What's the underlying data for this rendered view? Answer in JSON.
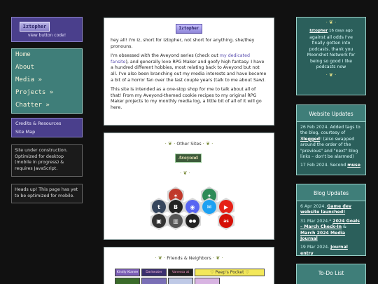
{
  "left": {
    "button_label": "Iztopher",
    "button_caption": "view button code!",
    "nav": [
      "Home",
      "About",
      "Media »",
      "Projects »",
      "Chatter »"
    ],
    "sub": [
      "Credits & Resources",
      "Site Map"
    ],
    "notice1": "Site under construction. Optimized for desktop (mobile in progress) & requires JavaScript.",
    "notice2": "Heads up! This page has yet to be optimized for mobile."
  },
  "intro": {
    "badge": "Iztopher",
    "p1": "hey all! I'm Iz, short for Iztopher, not short for anything. she/they pronouns.",
    "p2a": "I'm obsessed with the Aveyond series (check out ",
    "p2link": "my dedicated fansite",
    "p2b": "), and generally love RPG Maker and goofy high fantasy. I have a hundred different hobbies, most relating back to Aveyond but not all. I've also been branching out my media interests and have become a bit of a horror fan over the last couple years (talk to me about Saw).",
    "p3": "This site is intended as a one-stop shop for me to talk about all of that! From my Aveyond-themed cookie recipes to my original RPG Maker projects to my monthly media log, a little bit of all of it will go here."
  },
  "other_sites": {
    "title": "Other Sites",
    "button": "Aveyond",
    "icons": [
      {
        "name": "rpg-maker-icon",
        "glyph": "✶",
        "color": "#c0392b"
      },
      {
        "name": "fansite-icon",
        "glyph": "✦",
        "color": "#2e8b57"
      },
      {
        "name": "tumblr-icon",
        "glyph": "t",
        "color": "#36465d"
      },
      {
        "name": "bluesky-icon",
        "glyph": "B",
        "color": "#222"
      },
      {
        "name": "discord-icon",
        "glyph": "◉",
        "color": "#5865f2"
      },
      {
        "name": "twitter-icon",
        "glyph": "✉",
        "color": "#1da1f2"
      },
      {
        "name": "youtube-icon",
        "glyph": "▶",
        "color": "#e62117"
      },
      {
        "name": "itch-icon",
        "glyph": "▣",
        "color": "#333"
      },
      {
        "name": "library-icon",
        "glyph": "▥",
        "color": "#555"
      },
      {
        "name": "flickr-icon",
        "glyph": "●●",
        "color": "#fff"
      },
      {
        "name": "lastfm-icon",
        "glyph": "as",
        "color": "#d51007"
      }
    ]
  },
  "friends": {
    "title": "Friends & Neighbors",
    "buttons": [
      "Kindly Klanee",
      "Darkwater",
      "Vanessa at Internet",
      "♡ Peep's Pocket ♡"
    ]
  },
  "right": {
    "shout_name": "Iztopher",
    "shout_time": "16 days ago",
    "shout_text": "against all odds I've finally gotten into podcasts. thank you Moonshot Network for being so good I like podcasts now",
    "updates_title": "Website Updates",
    "u1_date": "26 Feb 2024.",
    "u1_text": " Added tags to the blog, courtesy of ",
    "u1_link": "3legged",
    "u1_text2": "! (also swapped around the order of the \"previous\" and \"next\" blog links – don't be alarmed)",
    "u2_date": "17 Feb 2024.",
    "u2_text": " Second ",
    "u2_link": "muse",
    "blog_title": "Blog Updates",
    "b1_date": "6 Apr 2024.",
    "b1_link": "Game dev website launched!",
    "b2_date": "31 Mar 2024.*",
    "b2_link": "2024 Goals – March Check-In",
    "b2_mid": " & ",
    "b2_link2": "March 2024 Media Journal",
    "b3_date": "19 Mar 2024.",
    "b3_link": "Journal entry",
    "todo_title": "To-Do List"
  }
}
